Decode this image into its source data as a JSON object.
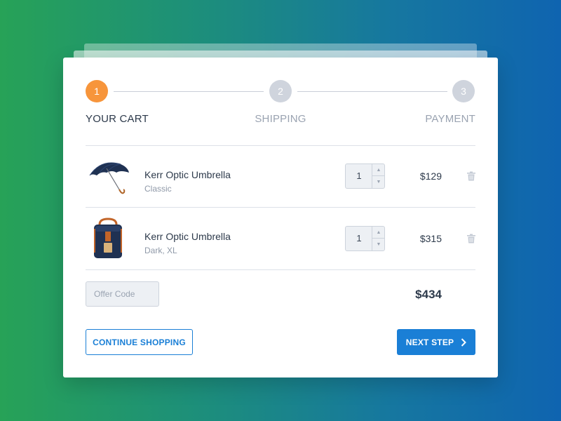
{
  "colors": {
    "accent": "#1a7fd6",
    "step_active": "#f7953b",
    "step_inactive": "#cfd4dd",
    "label_active": "#2d3a4b",
    "label_inactive": "#9aa3b1"
  },
  "steps": [
    {
      "number": "1",
      "label": "YOUR CART",
      "active": true
    },
    {
      "number": "2",
      "label": "SHIPPING",
      "active": false
    },
    {
      "number": "3",
      "label": "PAYMENT",
      "active": false
    }
  ],
  "cart": {
    "items": [
      {
        "name": "Kerr Optic Umbrella",
        "variant": "Classic",
        "quantity": "1",
        "price": "$129",
        "image": "umbrella"
      },
      {
        "name": "Kerr Optic Umbrella",
        "variant": "Dark, XL",
        "quantity": "1",
        "price": "$315",
        "image": "backpack"
      }
    ],
    "offer_code_placeholder": "Offer Code",
    "total": "$434"
  },
  "actions": {
    "continue_label": "CONTINUE SHOPPING",
    "next_label": "NEXT STEP"
  },
  "icons": {
    "remove": "trash-icon",
    "increment": "chevron-up-icon",
    "decrement": "chevron-down-icon",
    "next": "chevron-right-icon"
  }
}
